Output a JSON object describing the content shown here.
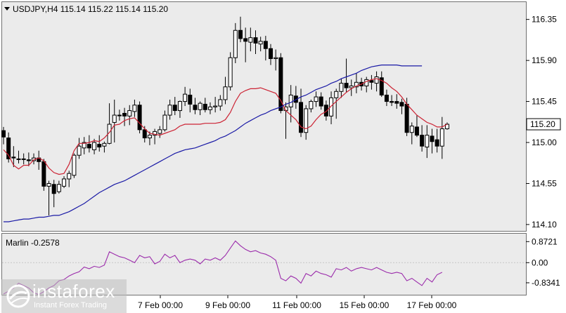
{
  "chart_data": [
    {
      "type": "candlestick",
      "title": "USDJPY,H4  115.14 115.22 115.14 115.20",
      "y_ticks": [
        "116.35",
        "115.90",
        "115.45",
        "115.00",
        "114.55",
        "114.10"
      ],
      "ylim": [
        114.03,
        116.54
      ],
      "current_price": "115.20",
      "x_ticks": [
        "7 Feb 00:00",
        "9 Feb 00:00",
        "11 Feb 00:00",
        "15 Feb 00:00",
        "17 Feb 00:00"
      ],
      "candles": [
        [
          115.13,
          115.17,
          114.98,
          115.06
        ],
        [
          115.05,
          115.11,
          114.78,
          114.82
        ],
        [
          114.84,
          114.96,
          114.73,
          114.83
        ],
        [
          114.82,
          114.91,
          114.77,
          114.82
        ],
        [
          114.82,
          114.88,
          114.76,
          114.82
        ],
        [
          114.81,
          114.89,
          114.74,
          114.8
        ],
        [
          114.8,
          114.88,
          114.76,
          114.83
        ],
        [
          114.83,
          114.91,
          114.7,
          114.79
        ],
        [
          114.79,
          114.82,
          114.47,
          114.52
        ],
        [
          114.52,
          114.58,
          114.2,
          114.55
        ],
        [
          114.54,
          114.59,
          114.29,
          114.44
        ],
        [
          114.46,
          114.58,
          114.44,
          114.54
        ],
        [
          114.52,
          114.63,
          114.5,
          114.6
        ],
        [
          114.6,
          114.69,
          114.51,
          114.66
        ],
        [
          114.64,
          114.88,
          114.61,
          114.86
        ],
        [
          114.86,
          115.05,
          114.82,
          114.96
        ],
        [
          114.94,
          115.06,
          114.87,
          115.0
        ],
        [
          114.98,
          115.08,
          114.89,
          114.94
        ],
        [
          114.92,
          115.04,
          114.87,
          115.0
        ],
        [
          114.98,
          115.08,
          114.9,
          114.95
        ],
        [
          114.96,
          115.01,
          114.89,
          114.99
        ],
        [
          114.99,
          115.43,
          114.98,
          115.2
        ],
        [
          115.22,
          115.47,
          115.0,
          115.3
        ],
        [
          115.3,
          115.36,
          115.24,
          115.3
        ],
        [
          115.32,
          115.38,
          115.18,
          115.29
        ],
        [
          115.29,
          115.41,
          115.19,
          115.35
        ],
        [
          115.34,
          115.47,
          115.28,
          115.41
        ],
        [
          115.41,
          115.45,
          115.1,
          115.14
        ],
        [
          115.14,
          115.18,
          115.0,
          115.05
        ],
        [
          115.05,
          115.12,
          114.97,
          115.08
        ],
        [
          115.08,
          115.15,
          114.98,
          115.12
        ],
        [
          115.1,
          115.18,
          115.05,
          115.14
        ],
        [
          115.14,
          115.35,
          115.12,
          115.3
        ],
        [
          115.3,
          115.47,
          115.25,
          115.41
        ],
        [
          115.41,
          115.5,
          115.3,
          115.35
        ],
        [
          115.35,
          115.46,
          115.27,
          115.45
        ],
        [
          115.45,
          115.61,
          115.4,
          115.53
        ],
        [
          115.52,
          115.59,
          115.33,
          115.42
        ],
        [
          115.41,
          115.49,
          115.31,
          115.36
        ],
        [
          115.36,
          115.45,
          115.3,
          115.43
        ],
        [
          115.42,
          115.49,
          115.33,
          115.36
        ],
        [
          115.36,
          115.44,
          115.31,
          115.39
        ],
        [
          115.39,
          115.5,
          115.33,
          115.4
        ],
        [
          115.4,
          115.52,
          115.35,
          115.47
        ],
        [
          115.47,
          115.72,
          115.42,
          115.61
        ],
        [
          115.61,
          115.99,
          115.57,
          115.93
        ],
        [
          115.93,
          116.31,
          115.87,
          116.23
        ],
        [
          116.23,
          116.38,
          116.1,
          116.14
        ],
        [
          116.14,
          116.26,
          115.88,
          116.11
        ],
        [
          116.1,
          116.26,
          116.0,
          116.15
        ],
        [
          116.15,
          116.23,
          115.97,
          116.09
        ],
        [
          116.08,
          116.16,
          116.0,
          116.11
        ],
        [
          116.11,
          116.17,
          115.9,
          116.03
        ],
        [
          116.03,
          116.08,
          115.85,
          115.92
        ],
        [
          115.92,
          116.02,
          115.79,
          115.93
        ],
        [
          115.93,
          115.98,
          115.32,
          115.35
        ],
        [
          115.35,
          115.44,
          115.04,
          115.39
        ],
        [
          115.39,
          115.63,
          115.22,
          115.52
        ],
        [
          115.51,
          115.62,
          115.37,
          115.44
        ],
        [
          115.44,
          115.59,
          115.06,
          115.11
        ],
        [
          115.11,
          115.41,
          115.03,
          115.37
        ],
        [
          115.37,
          115.47,
          115.33,
          115.45
        ],
        [
          115.45,
          115.56,
          115.39,
          115.5
        ],
        [
          115.5,
          115.55,
          115.36,
          115.4
        ],
        [
          115.41,
          115.46,
          115.24,
          115.29
        ],
        [
          115.29,
          115.56,
          115.2,
          115.49
        ],
        [
          115.49,
          115.59,
          115.26,
          115.56
        ],
        [
          115.56,
          115.7,
          115.49,
          115.65
        ],
        [
          115.65,
          115.92,
          115.55,
          115.6
        ],
        [
          115.6,
          115.69,
          115.51,
          115.62
        ],
        [
          115.61,
          115.76,
          115.54,
          115.66
        ],
        [
          115.66,
          115.71,
          115.57,
          115.62
        ],
        [
          115.62,
          115.72,
          115.55,
          115.69
        ],
        [
          115.68,
          115.74,
          115.58,
          115.66
        ],
        [
          115.65,
          115.78,
          115.56,
          115.72
        ],
        [
          115.71,
          115.78,
          115.5,
          115.52
        ],
        [
          115.52,
          115.58,
          115.4,
          115.45
        ],
        [
          115.45,
          115.52,
          115.4,
          115.44
        ],
        [
          115.45,
          115.53,
          115.37,
          115.43
        ],
        [
          115.44,
          115.48,
          115.31,
          115.4
        ],
        [
          115.42,
          115.49,
          115.07,
          115.11
        ],
        [
          115.11,
          115.22,
          114.98,
          115.18
        ],
        [
          115.17,
          115.3,
          115.06,
          115.08
        ],
        [
          115.08,
          115.19,
          114.9,
          114.96
        ],
        [
          114.95,
          115.19,
          114.83,
          115.08
        ],
        [
          115.07,
          115.15,
          114.88,
          115.01
        ],
        [
          115.03,
          115.15,
          114.89,
          114.96
        ],
        [
          114.96,
          115.28,
          114.82,
          115.15
        ],
        [
          115.15,
          115.22,
          115.14,
          115.2
        ]
      ],
      "series": [
        {
          "name": "",
          "color": "#cc2233",
          "values": [
            114.92,
            114.86,
            114.75,
            114.71,
            114.75,
            114.75,
            114.81,
            114.83,
            114.8,
            114.72,
            114.67,
            114.65,
            114.66,
            114.76,
            114.91,
            114.99,
            114.99,
            115.0,
            115.02,
            115.01,
            115.05,
            115.11,
            115.19,
            115.2,
            115.24,
            115.26,
            115.27,
            115.21,
            115.15,
            115.1,
            115.09,
            115.08,
            115.1,
            115.12,
            115.14,
            115.18,
            115.2,
            115.2,
            115.2,
            115.2,
            115.21,
            115.21,
            115.21,
            115.22,
            115.25,
            115.33,
            115.45,
            115.54,
            115.57,
            115.59,
            115.59,
            115.6,
            115.58,
            115.56,
            115.54,
            115.46,
            115.35,
            115.3,
            115.25,
            115.17,
            115.15,
            115.18,
            115.25,
            115.31,
            115.34,
            115.4,
            115.45,
            115.5,
            115.55,
            115.59,
            115.62,
            115.64,
            115.67,
            115.69,
            115.7,
            115.68,
            115.65,
            115.6,
            115.56,
            115.5,
            115.42,
            115.36,
            115.3,
            115.26,
            115.22,
            115.2,
            115.17,
            115.17,
            115.2
          ]
        },
        {
          "name": "",
          "color": "#1a1aa6",
          "values": [
            114.13,
            114.13,
            114.14,
            114.15,
            114.16,
            114.16,
            114.17,
            114.18,
            114.18,
            114.19,
            114.2,
            114.2,
            114.22,
            114.24,
            114.27,
            114.3,
            114.33,
            114.37,
            114.41,
            114.45,
            114.48,
            114.51,
            114.54,
            114.56,
            114.58,
            114.61,
            114.64,
            114.67,
            114.7,
            114.73,
            114.76,
            114.79,
            114.82,
            114.85,
            114.88,
            114.9,
            114.92,
            114.93,
            114.94,
            114.96,
            114.98,
            115.0,
            115.02,
            115.05,
            115.07,
            115.1,
            115.13,
            115.17,
            115.21,
            115.24,
            115.27,
            115.3,
            115.32,
            115.35,
            115.37,
            115.39,
            115.42,
            115.44,
            115.47,
            115.5,
            115.52,
            115.55,
            115.58,
            115.6,
            115.62,
            115.65,
            115.67,
            115.7,
            115.72,
            115.74,
            115.76,
            115.79,
            115.81,
            115.83,
            115.84,
            115.85,
            115.85,
            115.85,
            115.85,
            115.84,
            115.84,
            115.84,
            115.84,
            115.84
          ]
        }
      ]
    },
    {
      "type": "line",
      "title": "Marlin -0.2578",
      "y_ticks": [
        "0.8721",
        "0.00",
        "-0.8341"
      ],
      "ylim": [
        -1.33,
        1.2
      ],
      "series": [
        {
          "name": "Marlin",
          "color": "#9b2bab",
          "values": [
            -1.3,
            -1.18,
            -1.05,
            -0.85,
            -0.95,
            -1.05,
            -1.25,
            -1.32,
            -1.2,
            -1.05,
            -0.95,
            -0.75,
            -0.7,
            -0.55,
            -0.45,
            -0.38,
            -0.18,
            -0.25,
            -0.15,
            -0.2,
            -0.1,
            0.45,
            0.35,
            0.25,
            0.2,
            0.1,
            0.0,
            0.3,
            0.2,
            0.25,
            -0.05,
            0.05,
            0.35,
            0.2,
            0.3,
            0.0,
            0.1,
            0.15,
            0.1,
            -0.05,
            0.15,
            0.1,
            0.2,
            0.1,
            0.3,
            0.6,
            0.9,
            0.7,
            0.55,
            0.45,
            0.5,
            0.4,
            0.35,
            0.25,
            0.1,
            -0.65,
            -0.75,
            -0.55,
            -0.65,
            -0.85,
            -0.45,
            -0.55,
            -0.35,
            -0.45,
            -0.5,
            -0.6,
            -0.25,
            -0.3,
            -0.2,
            -0.35,
            -0.25,
            -0.2,
            -0.25,
            -0.3,
            -0.2,
            -0.3,
            -0.4,
            -0.45,
            -0.4,
            -0.45,
            -0.75,
            -0.65,
            -0.8,
            -0.95,
            -0.65,
            -0.8,
            -0.5,
            -0.4
          ]
        }
      ]
    }
  ],
  "branding": {
    "name": "instaforex",
    "tagline": "Instant Forex Trading"
  }
}
